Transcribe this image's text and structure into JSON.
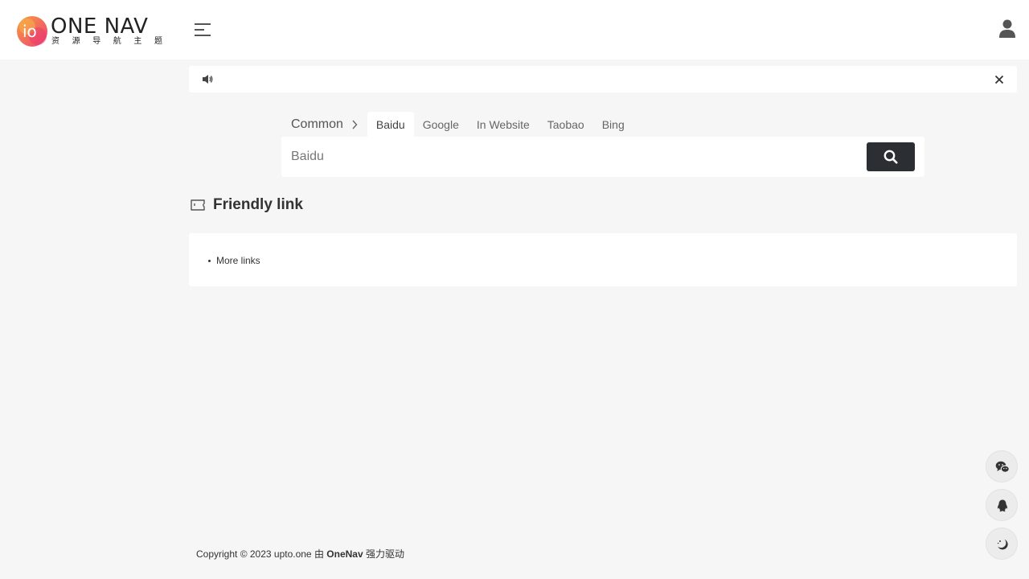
{
  "header": {
    "logo": {
      "badge_text": "io",
      "title": "ONE NAV",
      "subtitle_chars": [
        "资",
        "源",
        "导",
        "航",
        "主",
        "题"
      ]
    },
    "menu_icon": "hamburger-icon",
    "user_icon": "user-icon"
  },
  "notice": {
    "speaker_icon": "speaker-icon",
    "close_icon": "close-icon"
  },
  "search": {
    "group_label": "Common",
    "tabs": [
      {
        "label": "Baidu",
        "active": true
      },
      {
        "label": "Google",
        "active": false
      },
      {
        "label": "In Website",
        "active": false
      },
      {
        "label": "Taobao",
        "active": false
      },
      {
        "label": "Bing",
        "active": false
      }
    ],
    "placeholder": "Baidu",
    "value": "",
    "button_icon": "search-icon"
  },
  "friendly_links": {
    "title": "Friendly link",
    "items": [
      {
        "label": "More links"
      }
    ]
  },
  "footer": {
    "prefix": "Copyright © 2023 upto.one 由 ",
    "brand": "OneNav",
    "suffix": " 强力驱动"
  },
  "floating_buttons": [
    "wechat-icon",
    "qq-icon",
    "dark-mode-icon"
  ],
  "colors": {
    "background": "#f6f6f6",
    "surface": "#ffffff",
    "search_button": "#2b2f33",
    "logo_gradient_start": "#f6a03c",
    "logo_gradient_end": "#ee3f76"
  }
}
